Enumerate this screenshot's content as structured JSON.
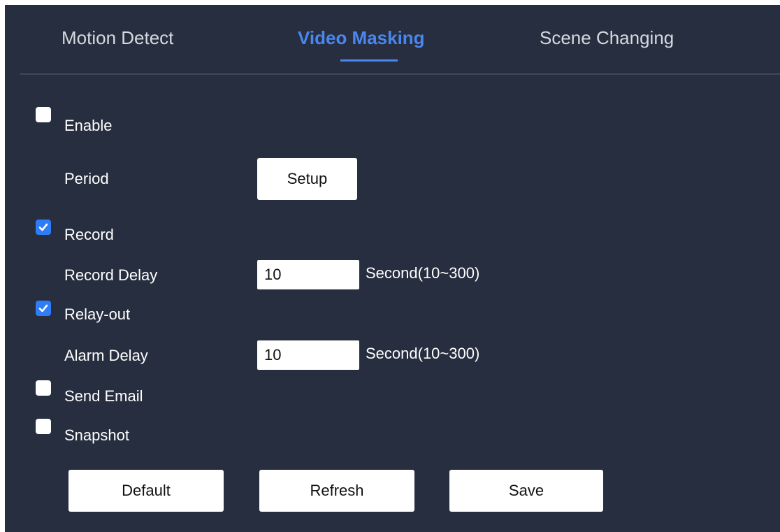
{
  "tabs": [
    {
      "label": "Motion Detect",
      "active": false
    },
    {
      "label": "Video Masking",
      "active": true
    },
    {
      "label": "Scene Changing",
      "active": false
    }
  ],
  "form": {
    "enable": {
      "label": "Enable",
      "checked": false
    },
    "period": {
      "label": "Period",
      "button_label": "Setup"
    },
    "record": {
      "label": "Record",
      "checked": true
    },
    "record_delay": {
      "label": "Record Delay",
      "value": "10",
      "unit": "Second(10~300)"
    },
    "relay_out": {
      "label": "Relay-out",
      "checked": true
    },
    "alarm_delay": {
      "label": "Alarm Delay",
      "value": "10",
      "unit": "Second(10~300)"
    },
    "send_email": {
      "label": "Send Email",
      "checked": false
    },
    "snapshot": {
      "label": "Snapshot",
      "checked": false
    }
  },
  "actions": {
    "default_label": "Default",
    "refresh_label": "Refresh",
    "save_label": "Save"
  },
  "colors": {
    "background": "#262e3f",
    "accent": "#4b86ee",
    "checkbox_checked": "#2f7cf6"
  }
}
